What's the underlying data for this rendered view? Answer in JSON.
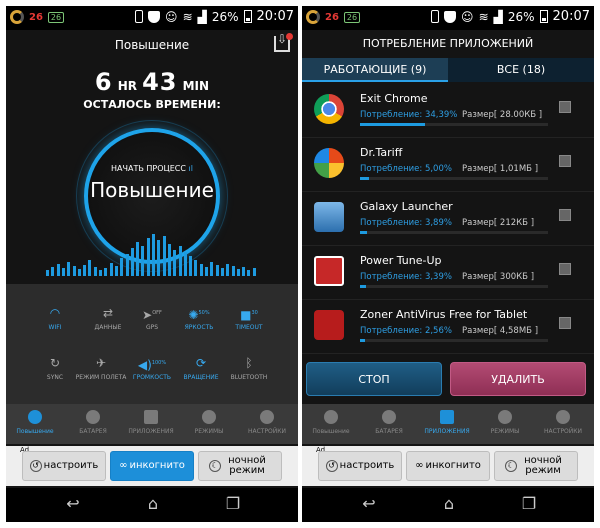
{
  "status_bar": {
    "left_number": "26",
    "left_badge": "26",
    "battery_percent": "26%",
    "time": "20:07"
  },
  "left_screen": {
    "header_title": "Повышение",
    "time_hours": "6",
    "time_hr_label": "HR",
    "time_minutes": "43",
    "time_min_label": "MIN",
    "time_remaining_label": "ОСТАЛОСЬ ВРЕМЕНИ:",
    "start_process": "НАЧАТЬ ПРОЦЕСС",
    "boost_word": "Повышение",
    "toggles": [
      {
        "label": "WIFI",
        "icon": "wifi-icon",
        "state": "on"
      },
      {
        "label": "ДАННЫЕ",
        "icon": "data-arrows-icon",
        "state": "off"
      },
      {
        "label": "GPS",
        "icon": "gps-icon",
        "state": "off",
        "badge": "OFF"
      },
      {
        "label": "ЯРКОСТЬ",
        "icon": "brightness-icon",
        "state": "on",
        "badge": "50%"
      },
      {
        "label": "TIMEOUT",
        "icon": "lock-icon",
        "state": "on",
        "badge": "30"
      },
      {
        "label": "SYNC",
        "icon": "sync-icon",
        "state": "off"
      },
      {
        "label": "РЕЖИМ ПОЛЕТА",
        "icon": "airplane-icon",
        "state": "off"
      },
      {
        "label": "ГРОМКОСТЬ",
        "icon": "volume-icon",
        "state": "on",
        "badge": "100%"
      },
      {
        "label": "ВРАЩЕНИЕ",
        "icon": "rotation-icon",
        "state": "on"
      },
      {
        "label": "BLUETOOTH",
        "icon": "bluetooth-icon",
        "state": "off"
      }
    ],
    "tabs": [
      {
        "label": "Повышение",
        "active": true
      },
      {
        "label": "БАТАРЕЯ",
        "active": false
      },
      {
        "label": "ПРИЛОЖЕНИЯ",
        "active": false
      },
      {
        "label": "РЕЖИМЫ",
        "active": false
      },
      {
        "label": "НАСТРОЙКИ",
        "active": false
      }
    ]
  },
  "right_screen": {
    "header_title": "ПОТРЕБЛЕНИЕ ПРИЛОЖЕНИЙ",
    "tab_running": "РАБОТАЮЩИЕ (9)",
    "tab_all": "ВСЕ (18)",
    "apps": [
      {
        "name": "Exit Chrome",
        "usage": "Потребление: 34,39%",
        "size": "Размер[ 28.00КБ ]",
        "usage_value": 34.39
      },
      {
        "name": "Dr.Tariff",
        "usage": "Потребление: 5,00%",
        "size": "Размер[ 1,01МБ ]",
        "usage_value": 5.0
      },
      {
        "name": "Galaxy Launcher",
        "usage": "Потребление: 3,89%",
        "size": "Размер[ 212КБ ]",
        "usage_value": 3.89
      },
      {
        "name": "Power Tune-Up",
        "usage": "Потребление: 3,39%",
        "size": "Размер[ 300КБ ]",
        "usage_value": 3.39
      },
      {
        "name": "Zoner AntiVirus Free for Tablet",
        "usage": "Потребление: 2,56%",
        "size": "Размер[ 4,58МБ ]",
        "usage_value": 2.56
      }
    ],
    "stop_button": "СТОП",
    "delete_button": "УДАЛИТЬ",
    "tabs": [
      {
        "label": "Повышение",
        "active": false
      },
      {
        "label": "БАТАРЕЯ",
        "active": false
      },
      {
        "label": "ПРИЛОЖЕНИЯ",
        "active": true
      },
      {
        "label": "РЕЖИМЫ",
        "active": false
      },
      {
        "label": "НАСТРОЙКИ",
        "active": false
      }
    ]
  },
  "ad_bar": {
    "ad_label": "Ad",
    "setup": "настроить",
    "incognito": "инкогнито",
    "night_mode": "ночной режим"
  },
  "colors": {
    "accent_blue": "#1e9be0",
    "delete_pink": "#a63d66",
    "stop_blue": "#1a5479"
  }
}
